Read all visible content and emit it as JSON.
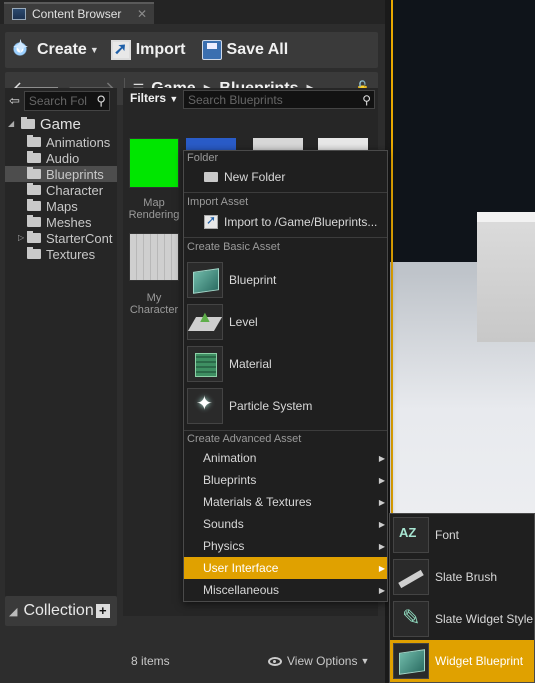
{
  "tab": {
    "title": "Content Browser",
    "close": "✕",
    "icon": "content-browser-icon"
  },
  "toolbar": {
    "create": "Create",
    "import": "Import",
    "save_all": "Save All"
  },
  "path": {
    "segments": [
      "Game",
      "Blueprints"
    ]
  },
  "sources": {
    "search_placeholder": "Search Fol",
    "root": "Game",
    "folders": [
      "Animations",
      "Audio",
      "Blueprints",
      "Character",
      "Maps",
      "Meshes",
      "StarterCont",
      "Textures"
    ],
    "selected": "Blueprints"
  },
  "collections": {
    "label": "Collection"
  },
  "assets": {
    "filters_label": "Filters",
    "search_placeholder": "Search Blueprints",
    "items": [
      {
        "label": "Map Rendering",
        "color": "#00e600"
      },
      {
        "label": "My Character",
        "color": "#dcdcdc"
      }
    ],
    "count": "8 items",
    "view_options": "View Options"
  },
  "menu": {
    "folder_header": "Folder",
    "new_folder": "New Folder",
    "import_header": "Import Asset",
    "import_to": "Import to /Game/Blueprints...",
    "basic_header": "Create Basic Asset",
    "basic": [
      {
        "label": "Blueprint",
        "icon": "blueprint-icon"
      },
      {
        "label": "Level",
        "icon": "level-icon"
      },
      {
        "label": "Material",
        "icon": "material-icon"
      },
      {
        "label": "Particle System",
        "icon": "particle-system-icon"
      }
    ],
    "advanced_header": "Create Advanced Asset",
    "advanced": [
      "Animation",
      "Blueprints",
      "Materials & Textures",
      "Sounds",
      "Physics",
      "User Interface",
      "Miscellaneous"
    ],
    "highlighted": "User Interface"
  },
  "submenu": {
    "items": [
      {
        "label": "Font",
        "icon": "font-icon"
      },
      {
        "label": "Slate Brush",
        "icon": "slate-brush-icon"
      },
      {
        "label": "Slate Widget Style",
        "icon": "slate-widget-style-icon"
      },
      {
        "label": "Widget Blueprint",
        "icon": "widget-blueprint-icon"
      }
    ],
    "highlighted": "Widget Blueprint"
  },
  "colors": {
    "highlight": "#e0a100",
    "panel": "#2d2d2d"
  }
}
